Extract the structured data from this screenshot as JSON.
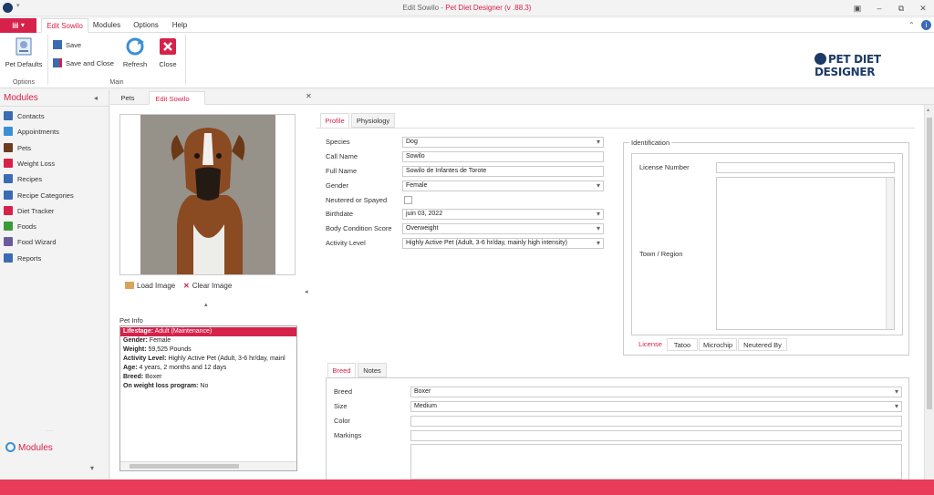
{
  "window": {
    "title_prefix": "Edit Sowilo - ",
    "title_app": "Pet Diet Designer",
    "title_version": " (v .88.3)"
  },
  "ribbon_tabs": [
    "Edit Sowilo",
    "Modules",
    "Options",
    "Help"
  ],
  "ribbon": {
    "pet_defaults": "Pet Defaults",
    "save": "Save",
    "save_close": "Save and Close",
    "refresh": "Refresh",
    "close": "Close",
    "group_options": "Options",
    "group_main": "Main"
  },
  "logo": "PET DIET DESIGNER",
  "sidebar": {
    "title": "Modules",
    "items": [
      {
        "label": "Contacts",
        "color": "#3b6bb3"
      },
      {
        "label": "Appointments",
        "color": "#3b8fd6"
      },
      {
        "label": "Pets",
        "color": "#6b3b1e"
      },
      {
        "label": "Weight Loss",
        "color": "#d6224a"
      },
      {
        "label": "Recipes",
        "color": "#3b6bb3"
      },
      {
        "label": "Recipe Categories",
        "color": "#3b6bb3"
      },
      {
        "label": "Diet Tracker",
        "color": "#d6224a"
      },
      {
        "label": "Foods",
        "color": "#3a9a3a"
      },
      {
        "label": "Food Wizard",
        "color": "#6b5b9b"
      },
      {
        "label": "Reports",
        "color": "#3b6bb3"
      }
    ],
    "footer": "Modules"
  },
  "doc_tabs": [
    "Pets",
    "Edit Sowilo"
  ],
  "image_buttons": {
    "load": "Load Image",
    "clear": "Clear Image"
  },
  "pet_info": {
    "title": "Pet Info",
    "rows": [
      {
        "k": "Lifestage:",
        "v": " Adult (Maintenance)"
      },
      {
        "k": "Gender:",
        "v": " Female"
      },
      {
        "k": "Weight:",
        "v": " 59,525 Pounds"
      },
      {
        "k": "Activity Level:",
        "v": " Highly Active Pet (Adult, 3-6 hr/day, mainl"
      },
      {
        "k": "Age:",
        "v": " 4 years, 2 months and 12 days"
      },
      {
        "k": "Breed:",
        "v": " Boxer"
      },
      {
        "k": "On weight loss program:",
        "v": " No"
      }
    ]
  },
  "profile_tabs": [
    "Profile",
    "Physiology"
  ],
  "profile": {
    "species_label": "Species",
    "species": "Dog",
    "call_name_label": "Call Name",
    "call_name": "Sowilo",
    "full_name_label": "Full Name",
    "full_name": "Sowilo de Infantes de Torote",
    "gender_label": "Gender",
    "gender": "Female",
    "neutered_label": "Neutered or Spayed",
    "birthdate_label": "Birthdate",
    "birthdate": "juin 03, 2022",
    "bcs_label": "Body Condition Score",
    "bcs": "Overweight",
    "activity_label": "Activity Level",
    "activity": "Highly Active Pet (Adult, 3-6 hr/day, mainly high intensity)"
  },
  "identification": {
    "title": "Identification",
    "license_label": "License Number",
    "town_label": "Town / Region",
    "tabs": [
      "License",
      "Tatoo",
      "Microchip",
      "Neutered By"
    ]
  },
  "breed_tabs": [
    "Breed",
    "Notes"
  ],
  "breed": {
    "breed_label": "Breed",
    "breed": "Boxer",
    "size_label": "Size",
    "size": "Medium",
    "color_label": "Color",
    "markings_label": "Markings"
  }
}
